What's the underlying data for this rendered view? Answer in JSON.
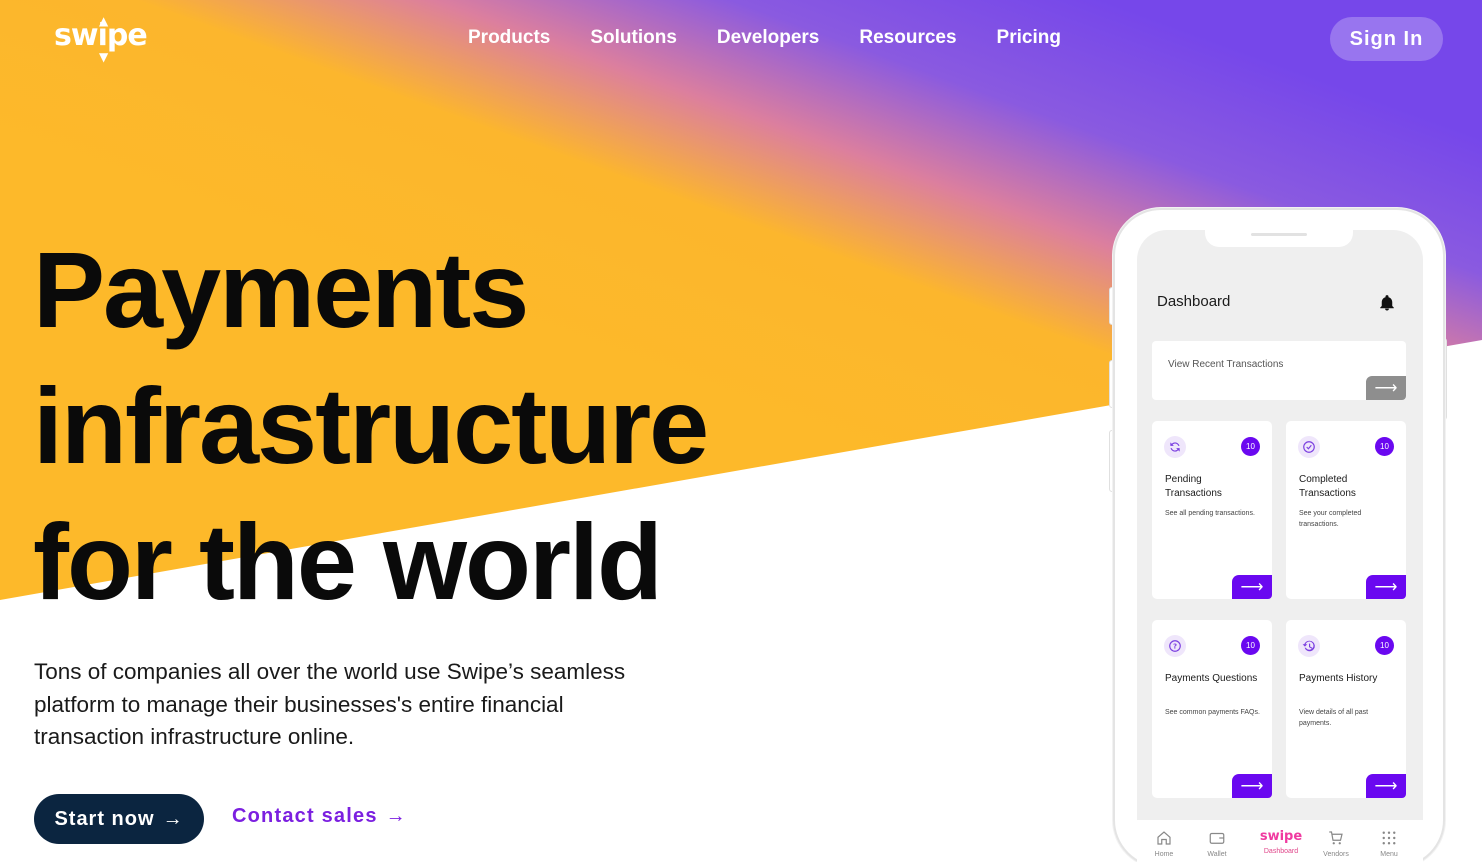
{
  "brand": {
    "logo_text": "swipe"
  },
  "nav": {
    "links": [
      "Products",
      "Solutions",
      "Developers",
      "Resources",
      "Pricing"
    ],
    "sign_in": "Sign In"
  },
  "hero": {
    "headline": [
      "Payments",
      "infrastructure",
      "for the world"
    ],
    "subtext": "Tons of companies all over the world use Swipe’s seamless platform to manage their businesses's entire financial transaction infrastructure online.",
    "cta_primary": "Start now",
    "cta_secondary": "Contact sales"
  },
  "phone": {
    "title": "Dashboard",
    "recent_label": "View Recent Transactions",
    "cards": [
      {
        "title": "Pending Transactions",
        "desc": "See all pending transactions.",
        "count": "10",
        "icon": "refresh-icon"
      },
      {
        "title": "Completed Transactions",
        "desc": "See your completed transactions.",
        "count": "10",
        "icon": "check-circle-icon"
      },
      {
        "title": "Payments Questions",
        "desc": "See common payments FAQs.",
        "count": "10",
        "icon": "question-icon"
      },
      {
        "title": "Payments History",
        "desc": "View details of all past payments.",
        "count": "10",
        "icon": "history-icon"
      }
    ],
    "tabs": [
      {
        "label": "Home",
        "icon": "home-icon"
      },
      {
        "label": "Wallet",
        "icon": "wallet-icon"
      },
      {
        "label": "Dashboard",
        "icon": "swipe-logo"
      },
      {
        "label": "Vendors",
        "icon": "cart-icon"
      },
      {
        "label": "Menu",
        "icon": "grid-icon"
      }
    ]
  },
  "colors": {
    "gradient_yellow": "#fdb92a",
    "gradient_purple": "#7c4fe6",
    "accent_purple": "#6a08f0",
    "link_purple": "#7b1fe0",
    "primary_button": "#0b2540"
  }
}
